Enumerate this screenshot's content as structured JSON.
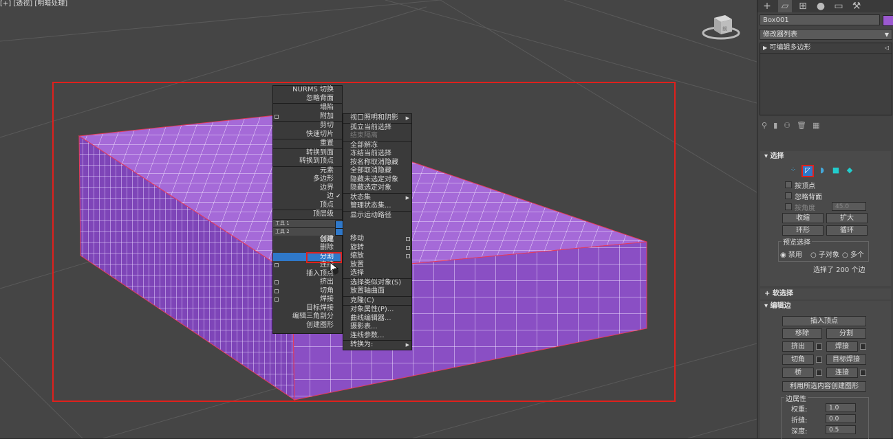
{
  "viewport": {
    "label": "[+] [透视] [明暗处理]",
    "viewcube_label": "前"
  },
  "quad_left": {
    "items": [
      {
        "label": "NURMS 切换",
        "checkbox": false
      },
      {
        "label": "忽略背面",
        "checkbox": false
      },
      {
        "label": "塌陷",
        "checkbox": false
      },
      {
        "label": "附加",
        "checkbox": true
      },
      {
        "label": "剪切",
        "checkbox": false
      },
      {
        "label": "快速切片",
        "checkbox": false
      },
      {
        "label": "重置",
        "checkbox": false
      },
      {
        "label": "转换到面",
        "checkbox": false
      },
      {
        "label": "转换到顶点",
        "checkbox": false
      },
      {
        "label": "元素",
        "checkbox": false
      },
      {
        "label": "多边形",
        "checkbox": false
      },
      {
        "label": "边界",
        "checkbox": false
      },
      {
        "label": "边",
        "checkbox": false,
        "checked": true
      },
      {
        "label": "顶点",
        "checkbox": false
      },
      {
        "label": "顶层级",
        "checkbox": false
      }
    ],
    "bar1": "工具 1",
    "bar2": "工具 2",
    "bar1_right": "显示",
    "bar2_right": "变换",
    "items2": [
      {
        "label": "创建",
        "checkbox": false,
        "bold": true
      },
      {
        "label": "删除",
        "checkbox": false
      },
      {
        "label": "分割",
        "checkbox": false,
        "highlight": true
      },
      {
        "label": "连接",
        "checkbox": true
      },
      {
        "label": "插入顶点",
        "checkbox": false
      },
      {
        "label": "挤出",
        "checkbox": true
      },
      {
        "label": "切角",
        "checkbox": true
      },
      {
        "label": "焊接",
        "checkbox": true
      },
      {
        "label": "目标焊接",
        "checkbox": false
      },
      {
        "label": "编辑三角剖分",
        "checkbox": false
      },
      {
        "label": "创建图形",
        "checkbox": false
      }
    ]
  },
  "quad_right": {
    "items": [
      {
        "label": "视口照明和阴影",
        "arrow": true
      },
      {
        "label": "孤立当前选择"
      },
      {
        "label": "结束隔离",
        "dim": true
      },
      {
        "label": "全部解冻"
      },
      {
        "label": "冻结当前选择"
      },
      {
        "label": "按名称取消隐藏"
      },
      {
        "label": "全部取消隐藏"
      },
      {
        "label": "隐藏未选定对象"
      },
      {
        "label": "隐藏选定对象"
      },
      {
        "label": "状态集",
        "arrow": true
      },
      {
        "label": "管理状态集..."
      },
      {
        "label": "显示运动路径"
      }
    ],
    "items2": [
      {
        "label": "移动",
        "box": true
      },
      {
        "label": "旋转",
        "box": true
      },
      {
        "label": "缩放",
        "box": true
      },
      {
        "label": "放置"
      },
      {
        "label": "选择"
      },
      {
        "label": "选择类似对象(S)"
      },
      {
        "label": "放置轴曲面"
      },
      {
        "label": "克隆(C)"
      },
      {
        "label": "对象属性(P)..."
      },
      {
        "label": "曲线编辑器..."
      },
      {
        "label": "摄影表..."
      },
      {
        "label": "连线参数..."
      },
      {
        "label": "转换为:",
        "arrow": true
      }
    ]
  },
  "panel": {
    "object_name": "Box001",
    "object_color": "#9b59d0",
    "modifier_list": "修改器列表",
    "stack_item": "可编辑多边形",
    "select_title": "选择",
    "by_vertex": "按顶点",
    "ignore_backface": "忽略背面",
    "by_angle": "按角度",
    "angle_value": "45.0",
    "shrink": "收缩",
    "grow": "扩大",
    "ring": "环形",
    "loop": "循环",
    "preview_title": "预览选择",
    "preview_opts": [
      "禁用",
      "子对象",
      "多个"
    ],
    "selected_info": "选择了 200 个边",
    "soft_select": "软选择",
    "edit_edges": "编辑边",
    "insert_vertex": "插入顶点",
    "remove": "移除",
    "split": "分割",
    "extrude": "挤出",
    "weld": "焊接",
    "chamfer": "切角",
    "target_weld": "目标焊接",
    "bridge": "桥",
    "connect": "连接",
    "create_shape": "利用所选内容创建图形",
    "edge_props": "边属性",
    "weight_label": "权重:",
    "weight_value": "1.0",
    "crease_label": "折缝:",
    "crease_value": "0.0",
    "depth_label": "深度:",
    "depth_value": "0.5"
  },
  "colors": {
    "object": "#9b59d0",
    "selection_frame": "#e0201c",
    "highlight": "#2f78c9"
  }
}
